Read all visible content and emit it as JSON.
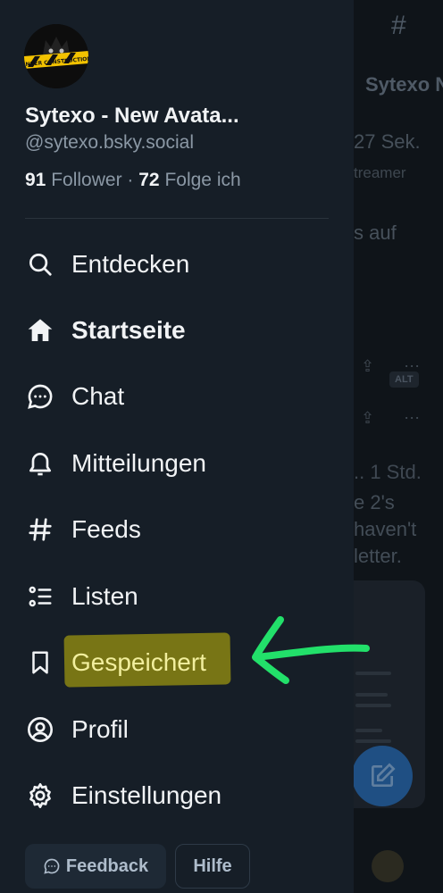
{
  "background_feed": {
    "hash_icon": "#",
    "author": "Sytexo N",
    "time": "27 Sek.",
    "handle_fragment": "treamer",
    "text_fragment": "s auf",
    "alt_badge": "ALT",
    "time2": ".. 1 Std.",
    "line1": "e 2's",
    "line2": "haven't",
    "line3": "letter."
  },
  "profile": {
    "display_name": "Sytexo - New Avata...",
    "handle": "@sytexo.bsky.social",
    "followers_count": "91",
    "followers_label": "Follower",
    "separator": "·",
    "following_count": "72",
    "following_label": "Folge ich",
    "avatar_icon": "under-construction-avatar"
  },
  "nav": {
    "items": [
      {
        "label": "Entdecken",
        "icon": "search-icon"
      },
      {
        "label": "Startseite",
        "icon": "home-icon"
      },
      {
        "label": "Chat",
        "icon": "chat-icon"
      },
      {
        "label": "Mitteilungen",
        "icon": "bell-icon"
      },
      {
        "label": "Feeds",
        "icon": "hash-icon"
      },
      {
        "label": "Listen",
        "icon": "list-icon"
      },
      {
        "label": "Gespeichert",
        "icon": "bookmark-icon"
      },
      {
        "label": "Profil",
        "icon": "profile-icon"
      },
      {
        "label": "Einstellungen",
        "icon": "gear-icon"
      }
    ]
  },
  "footer": {
    "feedback_label": "Feedback",
    "help_label": "Hilfe"
  },
  "colors": {
    "drawer_bg": "#161e27",
    "highlight": "#7d7a14",
    "arrow": "#22e06a",
    "accent": "#1f4f83"
  }
}
